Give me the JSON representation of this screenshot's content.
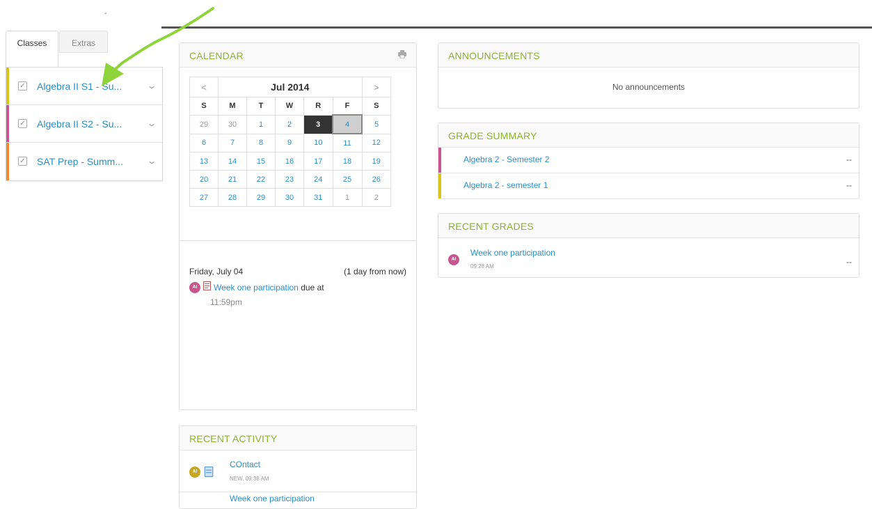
{
  "topbar": {
    "dash": "-"
  },
  "sidebar": {
    "tabs": [
      {
        "label": "Classes",
        "active": true
      },
      {
        "label": "Extras",
        "active": false
      }
    ],
    "classes": [
      {
        "name": "Algebra II S1 - Su...",
        "color": "#d9c417",
        "checked": true
      },
      {
        "name": "Algebra II S2 - Su...",
        "color": "#c9558f",
        "checked": true
      },
      {
        "name": "SAT Prep - Summ...",
        "color": "#ef8a2e",
        "checked": true
      }
    ]
  },
  "calendar": {
    "title": "CALENDAR",
    "month_label": "Jul 2014",
    "prev": "<",
    "next": ">",
    "weekdays": [
      "S",
      "M",
      "T",
      "W",
      "R",
      "F",
      "S"
    ],
    "weeks": [
      [
        "29",
        "30",
        "1",
        "2",
        "3",
        "4",
        "5"
      ],
      [
        "6",
        "7",
        "8",
        "9",
        "10",
        "11",
        "12"
      ],
      [
        "13",
        "14",
        "15",
        "16",
        "17",
        "18",
        "19"
      ],
      [
        "20",
        "21",
        "22",
        "23",
        "24",
        "25",
        "26"
      ],
      [
        "27",
        "28",
        "29",
        "30",
        "31",
        "1",
        "2"
      ]
    ],
    "today": "3",
    "selected": "4",
    "event": {
      "date": "Friday, July 04",
      "relative": "(1 day from now)",
      "avatar": "AI",
      "link": "Week one participation",
      "suffix": " due at",
      "time": "11:59pm"
    }
  },
  "recent_activity": {
    "title": "RECENT ACTIVITY",
    "items": [
      {
        "avatar": "AI",
        "title": "COntact",
        "meta": "NEW, 09:38 AM"
      }
    ],
    "next_partial": "Week one participation"
  },
  "announcements": {
    "title": "ANNOUNCEMENTS",
    "empty": "No announcements"
  },
  "grade_summary": {
    "title": "GRADE SUMMARY",
    "rows": [
      {
        "name": "Algebra 2 - Semester 2",
        "value": "--",
        "color": "#c9558f"
      },
      {
        "name": "Algebra 2 - semester 1",
        "value": "--",
        "color": "#d9c417"
      }
    ]
  },
  "recent_grades": {
    "title": "RECENT GRADES",
    "items": [
      {
        "avatar": "AI",
        "title": "Week one participation",
        "time": "09:28 AM",
        "value": "--"
      }
    ]
  },
  "colors": {
    "accent_green": "#8cb42f",
    "link_blue": "#2a8fc7",
    "annotation_arrow": "#8fd33a"
  }
}
